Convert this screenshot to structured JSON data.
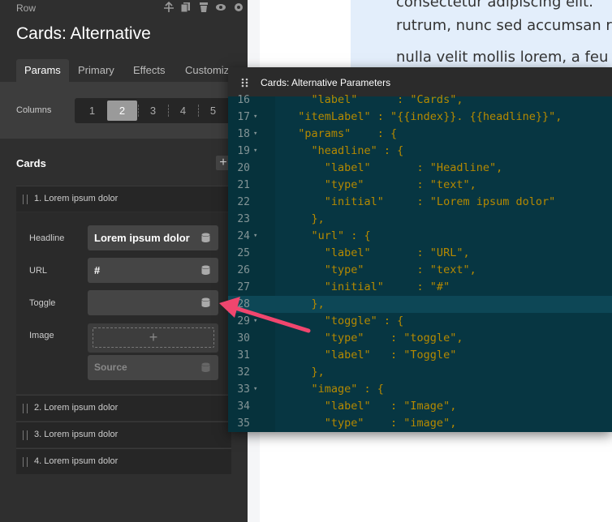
{
  "background": {
    "lines": [
      "consectetur adipiscing elit.",
      "rutrum, nunc sed accumsan r",
      "nulla velit mollis lorem, a feu"
    ]
  },
  "sidebar": {
    "breadcrumb": "Row",
    "title": "Cards: Alternative",
    "tabs": [
      "Params",
      "Primary",
      "Effects",
      "Customiz"
    ],
    "columns_label": "Columns",
    "columns": [
      "1",
      "2",
      "3",
      "4",
      "5"
    ],
    "cards_label": "Cards",
    "add_label": "+",
    "cards": [
      "1. Lorem ipsum dolor",
      "2. Lorem ipsum dolor",
      "3. Lorem ipsum dolor",
      "4. Lorem ipsum dolor"
    ],
    "fields": {
      "headline_label": "Headline",
      "headline_value": "Lorem ipsum dolor",
      "url_label": "URL",
      "url_value": "#",
      "toggle_label": "Toggle",
      "image_label": "Image",
      "image_add": "+",
      "source_placeholder": "Source"
    }
  },
  "editor": {
    "title": "Cards: Alternative Parameters",
    "lines": [
      {
        "n": "16",
        "fold": "",
        "text": "    \"label\"      : \"Cards\","
      },
      {
        "n": "17",
        "fold": "▾",
        "text": "  \"itemLabel\" : \"{{index}}. {{headline}}\","
      },
      {
        "n": "18",
        "fold": "▾",
        "text": "  \"params\"    : {"
      },
      {
        "n": "19",
        "fold": "▾",
        "text": "    \"headline\" : {"
      },
      {
        "n": "20",
        "fold": "",
        "text": "      \"label\"       : \"Headline\","
      },
      {
        "n": "21",
        "fold": "",
        "text": "      \"type\"        : \"text\","
      },
      {
        "n": "22",
        "fold": "",
        "text": "      \"initial\"     : \"Lorem ipsum dolor\""
      },
      {
        "n": "23",
        "fold": "",
        "text": "    },"
      },
      {
        "n": "24",
        "fold": "▾",
        "text": "    \"url\" : {"
      },
      {
        "n": "25",
        "fold": "",
        "text": "      \"label\"       : \"URL\","
      },
      {
        "n": "26",
        "fold": "",
        "text": "      \"type\"        : \"text\","
      },
      {
        "n": "27",
        "fold": "",
        "text": "      \"initial\"     : \"#\""
      },
      {
        "n": "28",
        "fold": "",
        "text": "    },"
      },
      {
        "n": "29",
        "fold": "▾",
        "text": "      \"toggle\" : {"
      },
      {
        "n": "30",
        "fold": "",
        "text": "      \"type\"    : \"toggle\","
      },
      {
        "n": "31",
        "fold": "",
        "text": "      \"label\"   : \"Toggle\""
      },
      {
        "n": "32",
        "fold": "",
        "text": "    },"
      },
      {
        "n": "33",
        "fold": "▾",
        "text": "    \"image\" : {"
      },
      {
        "n": "34",
        "fold": "",
        "text": "      \"label\"   : \"Image\","
      },
      {
        "n": "35",
        "fold": "",
        "text": "      \"type\"    : \"image\","
      }
    ]
  },
  "colors": {
    "accent_arrow": "#f0466e",
    "editor_bg": "#073642",
    "code_text": "#b58900"
  }
}
